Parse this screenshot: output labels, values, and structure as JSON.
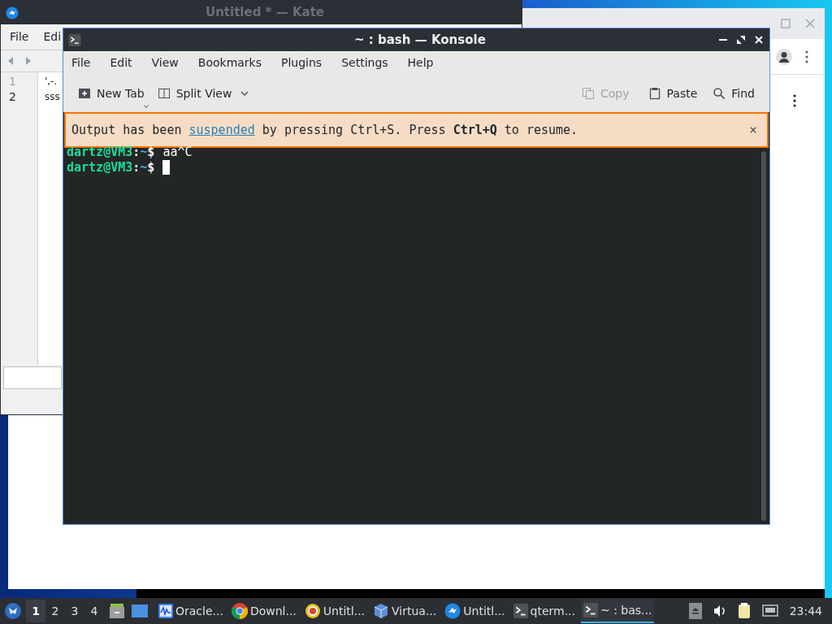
{
  "kate": {
    "title": "Untitled * — Kate",
    "menu": [
      "File",
      "Edi"
    ],
    "line_numbers": [
      {
        "text": "1",
        "current": false
      },
      {
        "text": "2",
        "current": true
      }
    ],
    "lines": [
      "',-.",
      "sss"
    ]
  },
  "konsole": {
    "title": "~ : bash — Konsole",
    "menu": [
      "File",
      "Edit",
      "View",
      "Bookmarks",
      "Plugins",
      "Settings",
      "Help"
    ],
    "toolbar": [
      {
        "kind": "new-tab",
        "label": "New Tab",
        "disabled": false
      },
      {
        "kind": "split",
        "label": "Split View",
        "disabled": false
      },
      {
        "kind": "copy",
        "label": "Copy",
        "disabled": true
      },
      {
        "kind": "paste",
        "label": "Paste",
        "disabled": false
      },
      {
        "kind": "find",
        "label": "Find",
        "disabled": false
      }
    ],
    "banner": {
      "before": "Output has been",
      "link": "suspended",
      "after": "by pressing Ctrl+S. Press **Ctrl+Q** to resume.",
      "close": "×"
    },
    "terminal": [
      {
        "user": "dartz@VM3",
        "sep": ":",
        "path": "~",
        "dollar": "$",
        "command": "aa^C",
        "cursor": false
      },
      {
        "user": "dartz@VM3",
        "sep": ":",
        "path": "~",
        "dollar": "$",
        "cursor": true
      }
    ]
  },
  "taskbar": {
    "desktops": [
      {
        "label": "1",
        "selected": true
      },
      {
        "label": "2",
        "selected": false
      },
      {
        "label": "3",
        "selected": false
      },
      {
        "label": "4",
        "selected": false
      }
    ],
    "tasks": [
      {
        "kind": "monitor",
        "label": "Oracle...",
        "selected": false
      },
      {
        "kind": "chrome",
        "label": "Downl...",
        "selected": false
      },
      {
        "kind": "target",
        "label": "Untitl...",
        "selected": false
      },
      {
        "kind": "vbox",
        "label": "Virtua...",
        "selected": false
      },
      {
        "kind": "kate",
        "label": "Untitl...",
        "selected": false
      },
      {
        "kind": "terminal",
        "label": "qterm...",
        "selected": false
      },
      {
        "kind": "terminal",
        "label": "~ : bas...",
        "selected": true
      }
    ],
    "clock": "23:44"
  }
}
